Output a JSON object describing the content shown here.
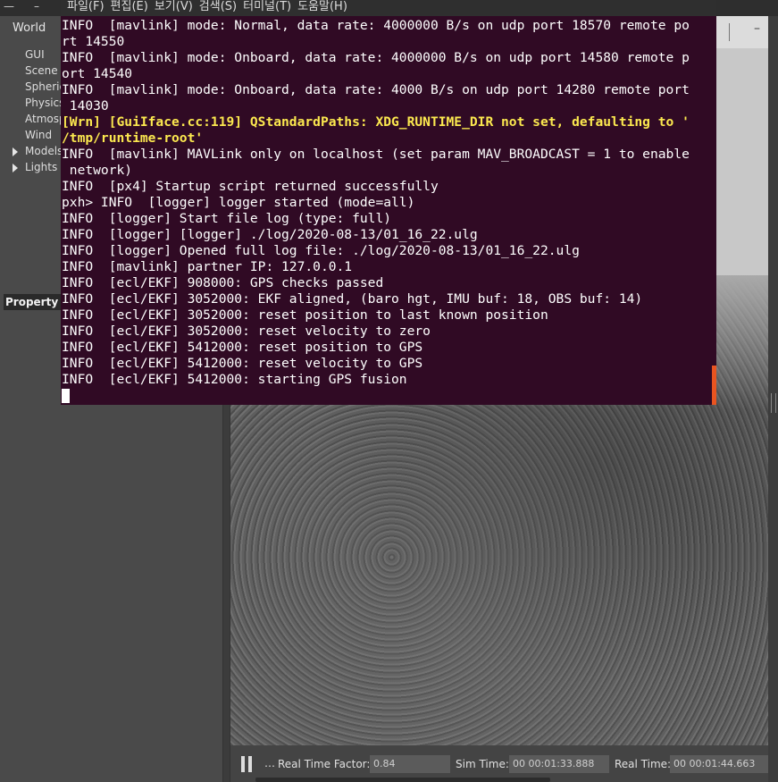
{
  "gazebo": {
    "world_tab": "World",
    "tree_items": [
      {
        "label": "GUI",
        "expandable": false
      },
      {
        "label": "Scene",
        "expandable": false
      },
      {
        "label": "Spherical",
        "expandable": false
      },
      {
        "label": "Physics",
        "expandable": false
      },
      {
        "label": "Atmosphere",
        "expandable": false
      },
      {
        "label": "Wind",
        "expandable": false
      },
      {
        "label": "Models",
        "expandable": true
      },
      {
        "label": "Lights",
        "expandable": true
      }
    ],
    "property_header": "Property",
    "bottom_bar": {
      "step_label": "…",
      "real_time_factor_label": "Real Time Factor:",
      "real_time_factor_value": "0.84",
      "sim_time_label": "Sim Time:",
      "sim_time_value": "00 00:01:33.888",
      "real_time_label": "Real Time:",
      "real_time_value": "00 00:01:44.663"
    }
  },
  "terminal": {
    "menu": [
      "파일(F)",
      "편집(E)",
      "보기(V)",
      "검색(S)",
      "터미널(T)",
      "도움말(H)"
    ],
    "lines": [
      {
        "text": "INFO  [mavlink] mode: Normal, data rate: 4000000 B/s on udp port 18570 remote po",
        "kind": "info"
      },
      {
        "text": "rt 14550",
        "kind": "info"
      },
      {
        "text": "INFO  [mavlink] mode: Onboard, data rate: 4000000 B/s on udp port 14580 remote p",
        "kind": "info"
      },
      {
        "text": "ort 14540",
        "kind": "info"
      },
      {
        "text": "INFO  [mavlink] mode: Onboard, data rate: 4000 B/s on udp port 14280 remote port",
        "kind": "info"
      },
      {
        "text": " 14030",
        "kind": "info"
      },
      {
        "text": "[Wrn] [GuiIface.cc:119] QStandardPaths: XDG_RUNTIME_DIR not set, defaulting to '",
        "kind": "warn"
      },
      {
        "text": "/tmp/runtime-root'",
        "kind": "warn"
      },
      {
        "text": "INFO  [mavlink] MAVLink only on localhost (set param MAV_BROADCAST = 1 to enable",
        "kind": "info"
      },
      {
        "text": " network)",
        "kind": "info"
      },
      {
        "text": "INFO  [px4] Startup script returned successfully",
        "kind": "info"
      },
      {
        "text": "pxh> INFO  [logger] logger started (mode=all)",
        "kind": "info"
      },
      {
        "text": "INFO  [logger] Start file log (type: full)",
        "kind": "info"
      },
      {
        "text": "INFO  [logger] [logger] ./log/2020-08-13/01_16_22.ulg",
        "kind": "info"
      },
      {
        "text": "INFO  [logger] Opened full log file: ./log/2020-08-13/01_16_22.ulg",
        "kind": "info"
      },
      {
        "text": "INFO  [mavlink] partner IP: 127.0.0.1",
        "kind": "info"
      },
      {
        "text": "INFO  [ecl/EKF] 908000: GPS checks passed",
        "kind": "info"
      },
      {
        "text": "INFO  [ecl/EKF] 3052000: EKF aligned, (baro hgt, IMU buf: 18, OBS buf: 14)",
        "kind": "info"
      },
      {
        "text": "INFO  [ecl/EKF] 3052000: reset position to last known position",
        "kind": "info"
      },
      {
        "text": "INFO  [ecl/EKF] 3052000: reset velocity to zero",
        "kind": "info"
      },
      {
        "text": "INFO  [ecl/EKF] 5412000: reset position to GPS",
        "kind": "info"
      },
      {
        "text": "INFO  [ecl/EKF] 5412000: reset velocity to GPS",
        "kind": "info"
      },
      {
        "text": "INFO  [ecl/EKF] 5412000: starting GPS fusion",
        "kind": "info"
      }
    ],
    "colors": {
      "background": "#300a24",
      "text": "#ffffff",
      "warning": "#fce94f",
      "scrollbar": "#e95420"
    }
  }
}
